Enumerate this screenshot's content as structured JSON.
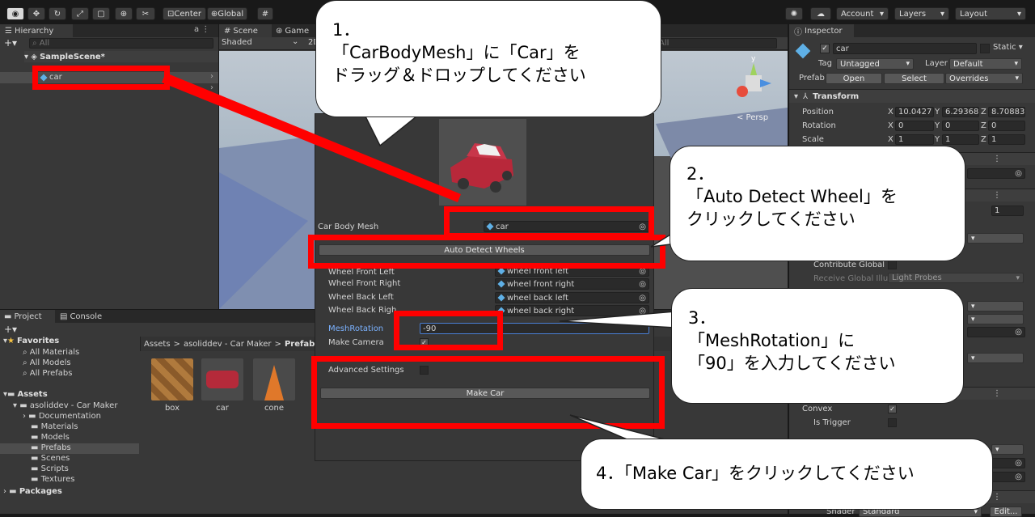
{
  "toolbar": {
    "center": "Center",
    "global": "Global",
    "account": "Account",
    "layers": "Layers",
    "layout": "Layout"
  },
  "hierarchy": {
    "tab": "Hierarchy",
    "search_placeholder": "All",
    "scene": "SampleScene*",
    "item": "car"
  },
  "scene_view": {
    "tab_scene": "Scene",
    "tab_game": "Game",
    "shaded": "Shaded",
    "mode2d": "2D",
    "search_placeholder": "All",
    "persp": "< Persp"
  },
  "project": {
    "tab_project": "Project",
    "tab_console": "Console",
    "favorites": "Favorites",
    "fav_items": [
      "All Materials",
      "All Models",
      "All Prefabs"
    ],
    "assets": "Assets",
    "folder": "asoliddev - Car Maker",
    "subfolders": [
      "Documentation",
      "Materials",
      "Models",
      "Prefabs",
      "Scenes",
      "Scripts",
      "Textures"
    ],
    "packages": "Packages",
    "breadcrumb": [
      "Assets",
      "asoliddev - Car Maker",
      "Prefabs"
    ],
    "thumbs": [
      "box",
      "car",
      "cone"
    ]
  },
  "carmaker": {
    "car_body_mesh_label": "Car Body Mesh",
    "car_body_mesh_value": "car",
    "auto_detect": "Auto Detect Wheels",
    "wheels": [
      {
        "label": "Wheel Front Left",
        "value": "wheel front left"
      },
      {
        "label": "Wheel Front Right",
        "value": "wheel front right"
      },
      {
        "label": "Wheel Back Left",
        "value": "wheel back left"
      },
      {
        "label": "Wheel Back Righ",
        "value": "wheel back right"
      }
    ],
    "mesh_rotation_label": "MeshRotation",
    "mesh_rotation_value": "-90",
    "make_camera_label": "Make Camera",
    "advanced_label": "Advanced Settings",
    "make_car": "Make Car"
  },
  "inspector": {
    "tab": "Inspector",
    "name": "car",
    "static": "Static",
    "tag_label": "Tag",
    "tag_value": "Untagged",
    "layer_label": "Layer",
    "layer_value": "Default",
    "prefab_label": "Prefab",
    "open": "Open",
    "select": "Select",
    "overrides": "Overrides",
    "transform": "Transform",
    "position_label": "Position",
    "position": [
      "10.0427",
      "6.29368",
      "8.70883"
    ],
    "rotation_label": "Rotation",
    "rotation": [
      "0",
      "0",
      "0"
    ],
    "scale_label": "Scale",
    "scale": [
      "1",
      "1",
      "1"
    ],
    "axis_x": "X",
    "axis_y": "Y",
    "axis_z": "Z",
    "field_one": "1",
    "contribute": "Contribute Global I",
    "receive": "Receive Global Illu",
    "light_probes": "Light Probes",
    "convex": "Convex",
    "is_trigger": "Is Trigger",
    "shader_label": "Shader",
    "shader_value": "Standard",
    "edit": "Edit..."
  },
  "callouts": {
    "c1": [
      "1．",
      "「CarBodyMesh」に「Car」を",
      "ドラッグ＆ドロップしてください"
    ],
    "c2": [
      "2．",
      "「Auto Detect Wheel」を",
      "クリックしてください"
    ],
    "c3": [
      "3．",
      "「MeshRotation」に",
      "「90」を入力してください"
    ],
    "c4": "4．「Make Car」をクリックしてください"
  },
  "colors": {
    "highlight": "#ff0000",
    "accent_blue": "#5fb0e6"
  }
}
